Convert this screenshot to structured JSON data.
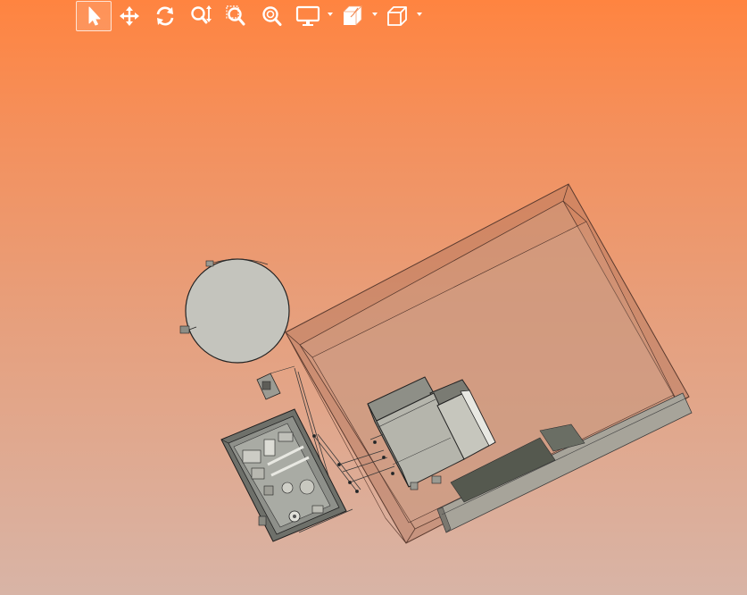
{
  "viewer": {
    "background": {
      "top_color": "#ff8440",
      "bottom_color": "#d8b4a6"
    },
    "toolbar": {
      "tools": [
        {
          "id": "select",
          "icon": "cursor-arrow-icon",
          "active": true,
          "has_menu": false
        },
        {
          "id": "pan",
          "icon": "move-arrows-icon",
          "active": false,
          "has_menu": false
        },
        {
          "id": "rotate",
          "icon": "rotate-icon",
          "active": false,
          "has_menu": false
        },
        {
          "id": "zoom",
          "icon": "zoom-updown-icon",
          "active": false,
          "has_menu": false
        },
        {
          "id": "zoom-window",
          "icon": "zoom-window-icon",
          "active": false,
          "has_menu": false
        },
        {
          "id": "zoom-fit",
          "icon": "zoom-fit-icon",
          "active": false,
          "has_menu": false
        },
        {
          "id": "display",
          "icon": "monitor-icon",
          "active": false,
          "has_menu": true
        },
        {
          "id": "view-orientation",
          "icon": "view-cube-icon",
          "active": false,
          "has_menu": true
        },
        {
          "id": "projection",
          "icon": "box-outline-icon",
          "active": false,
          "has_menu": true
        }
      ]
    },
    "model": {
      "parts": [
        "tank-disc",
        "small-bracket",
        "control-panel-board",
        "enclosure-shell",
        "unit-block",
        "base-rail"
      ]
    }
  }
}
